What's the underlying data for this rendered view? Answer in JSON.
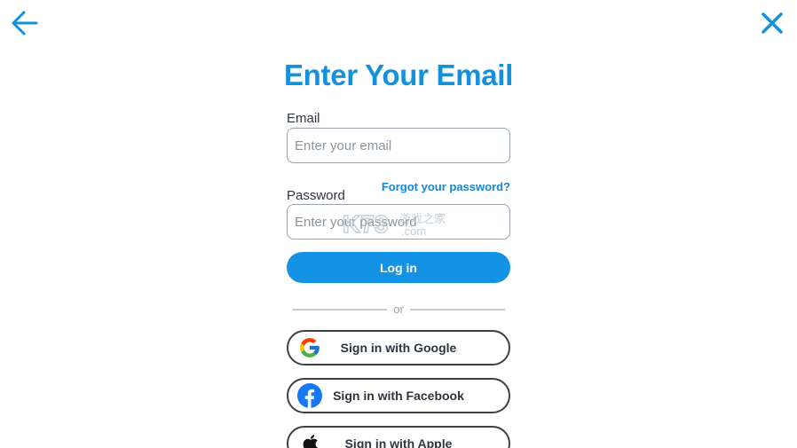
{
  "header": {
    "back_icon": "arrow-left-icon",
    "close_icon": "close-icon",
    "accent_color": "#1291dd"
  },
  "form": {
    "title": "Enter Your Email",
    "email_label": "Email",
    "email_placeholder": "Enter your email",
    "email_value": "",
    "password_label": "Password",
    "password_placeholder": "Enter your password",
    "password_value": "",
    "forgot_link": "Forgot your password?",
    "login_button": "Log in",
    "login_color": "#1492e6"
  },
  "divider": {
    "text": "or"
  },
  "social": [
    {
      "label": "Sign in with Google",
      "icon": "google-icon"
    },
    {
      "label": "Sign in with Facebook",
      "icon": "facebook-icon"
    },
    {
      "label": "Sign in with Apple",
      "icon": "apple-icon"
    }
  ],
  "watermark": {
    "brand": "K73",
    "sub": "游戏之家",
    "domain": ".com"
  }
}
